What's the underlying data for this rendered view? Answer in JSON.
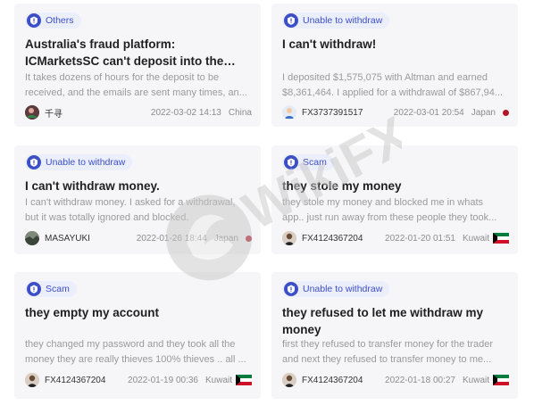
{
  "watermark": {
    "text": "WikiFX"
  },
  "cards": [
    {
      "tag": "Others",
      "title": "Australia's fraud platform: ICMarketsSC can't deposit into the account, and the...",
      "desc": "It takes dozens of hours for the deposit to be received, and the emails are sent many times, an...",
      "user": "千寻",
      "date": "2022-03-02 14:13",
      "country": "China"
    },
    {
      "tag": "Unable to withdraw",
      "title": "I can't withdraw!",
      "desc": "I deposited $1,575,075 with Altman and earned $8,361,464. I applied for a withdrawal of $867,94...",
      "user": "FX3737391517",
      "date": "2022-03-01 20:54",
      "country": "Japan"
    },
    {
      "tag": "Unable to withdraw",
      "title": "I can't withdraw money.",
      "desc": "I can't withdraw money. I asked for a withdrawal, but it was totally ignored and blocked.",
      "user": "MASAYUKI",
      "date": "2022-01-26 18:44",
      "country": "Japan"
    },
    {
      "tag": "Scam",
      "title": "they stole my money",
      "desc": "they stole my money and blocked me in whats app.. just run away from these people they took...",
      "user": "FX4124367204",
      "date": "2022-01-20 01:51",
      "country": "Kuwait"
    },
    {
      "tag": "Scam",
      "title": "they empty my account",
      "desc": "they changed my password and they took all the money they are really thieves 100% thieves .. all ...",
      "user": "FX4124367204",
      "date": "2022-01-19 00:36",
      "country": "Kuwait"
    },
    {
      "tag": "Unable to withdraw",
      "title": "they refused to let me withdraw my money",
      "desc": "first they refused to transfer money for the trader and next they refused to transfer money to me...",
      "user": "FX4124367204",
      "date": "2022-01-18 00:27",
      "country": "Kuwait"
    }
  ],
  "colors": {
    "accent": "#3d4fc7",
    "tag_bg": "#ebeefb",
    "card_bg": "#f6f6f8",
    "japan_dot": "#b0182a"
  }
}
